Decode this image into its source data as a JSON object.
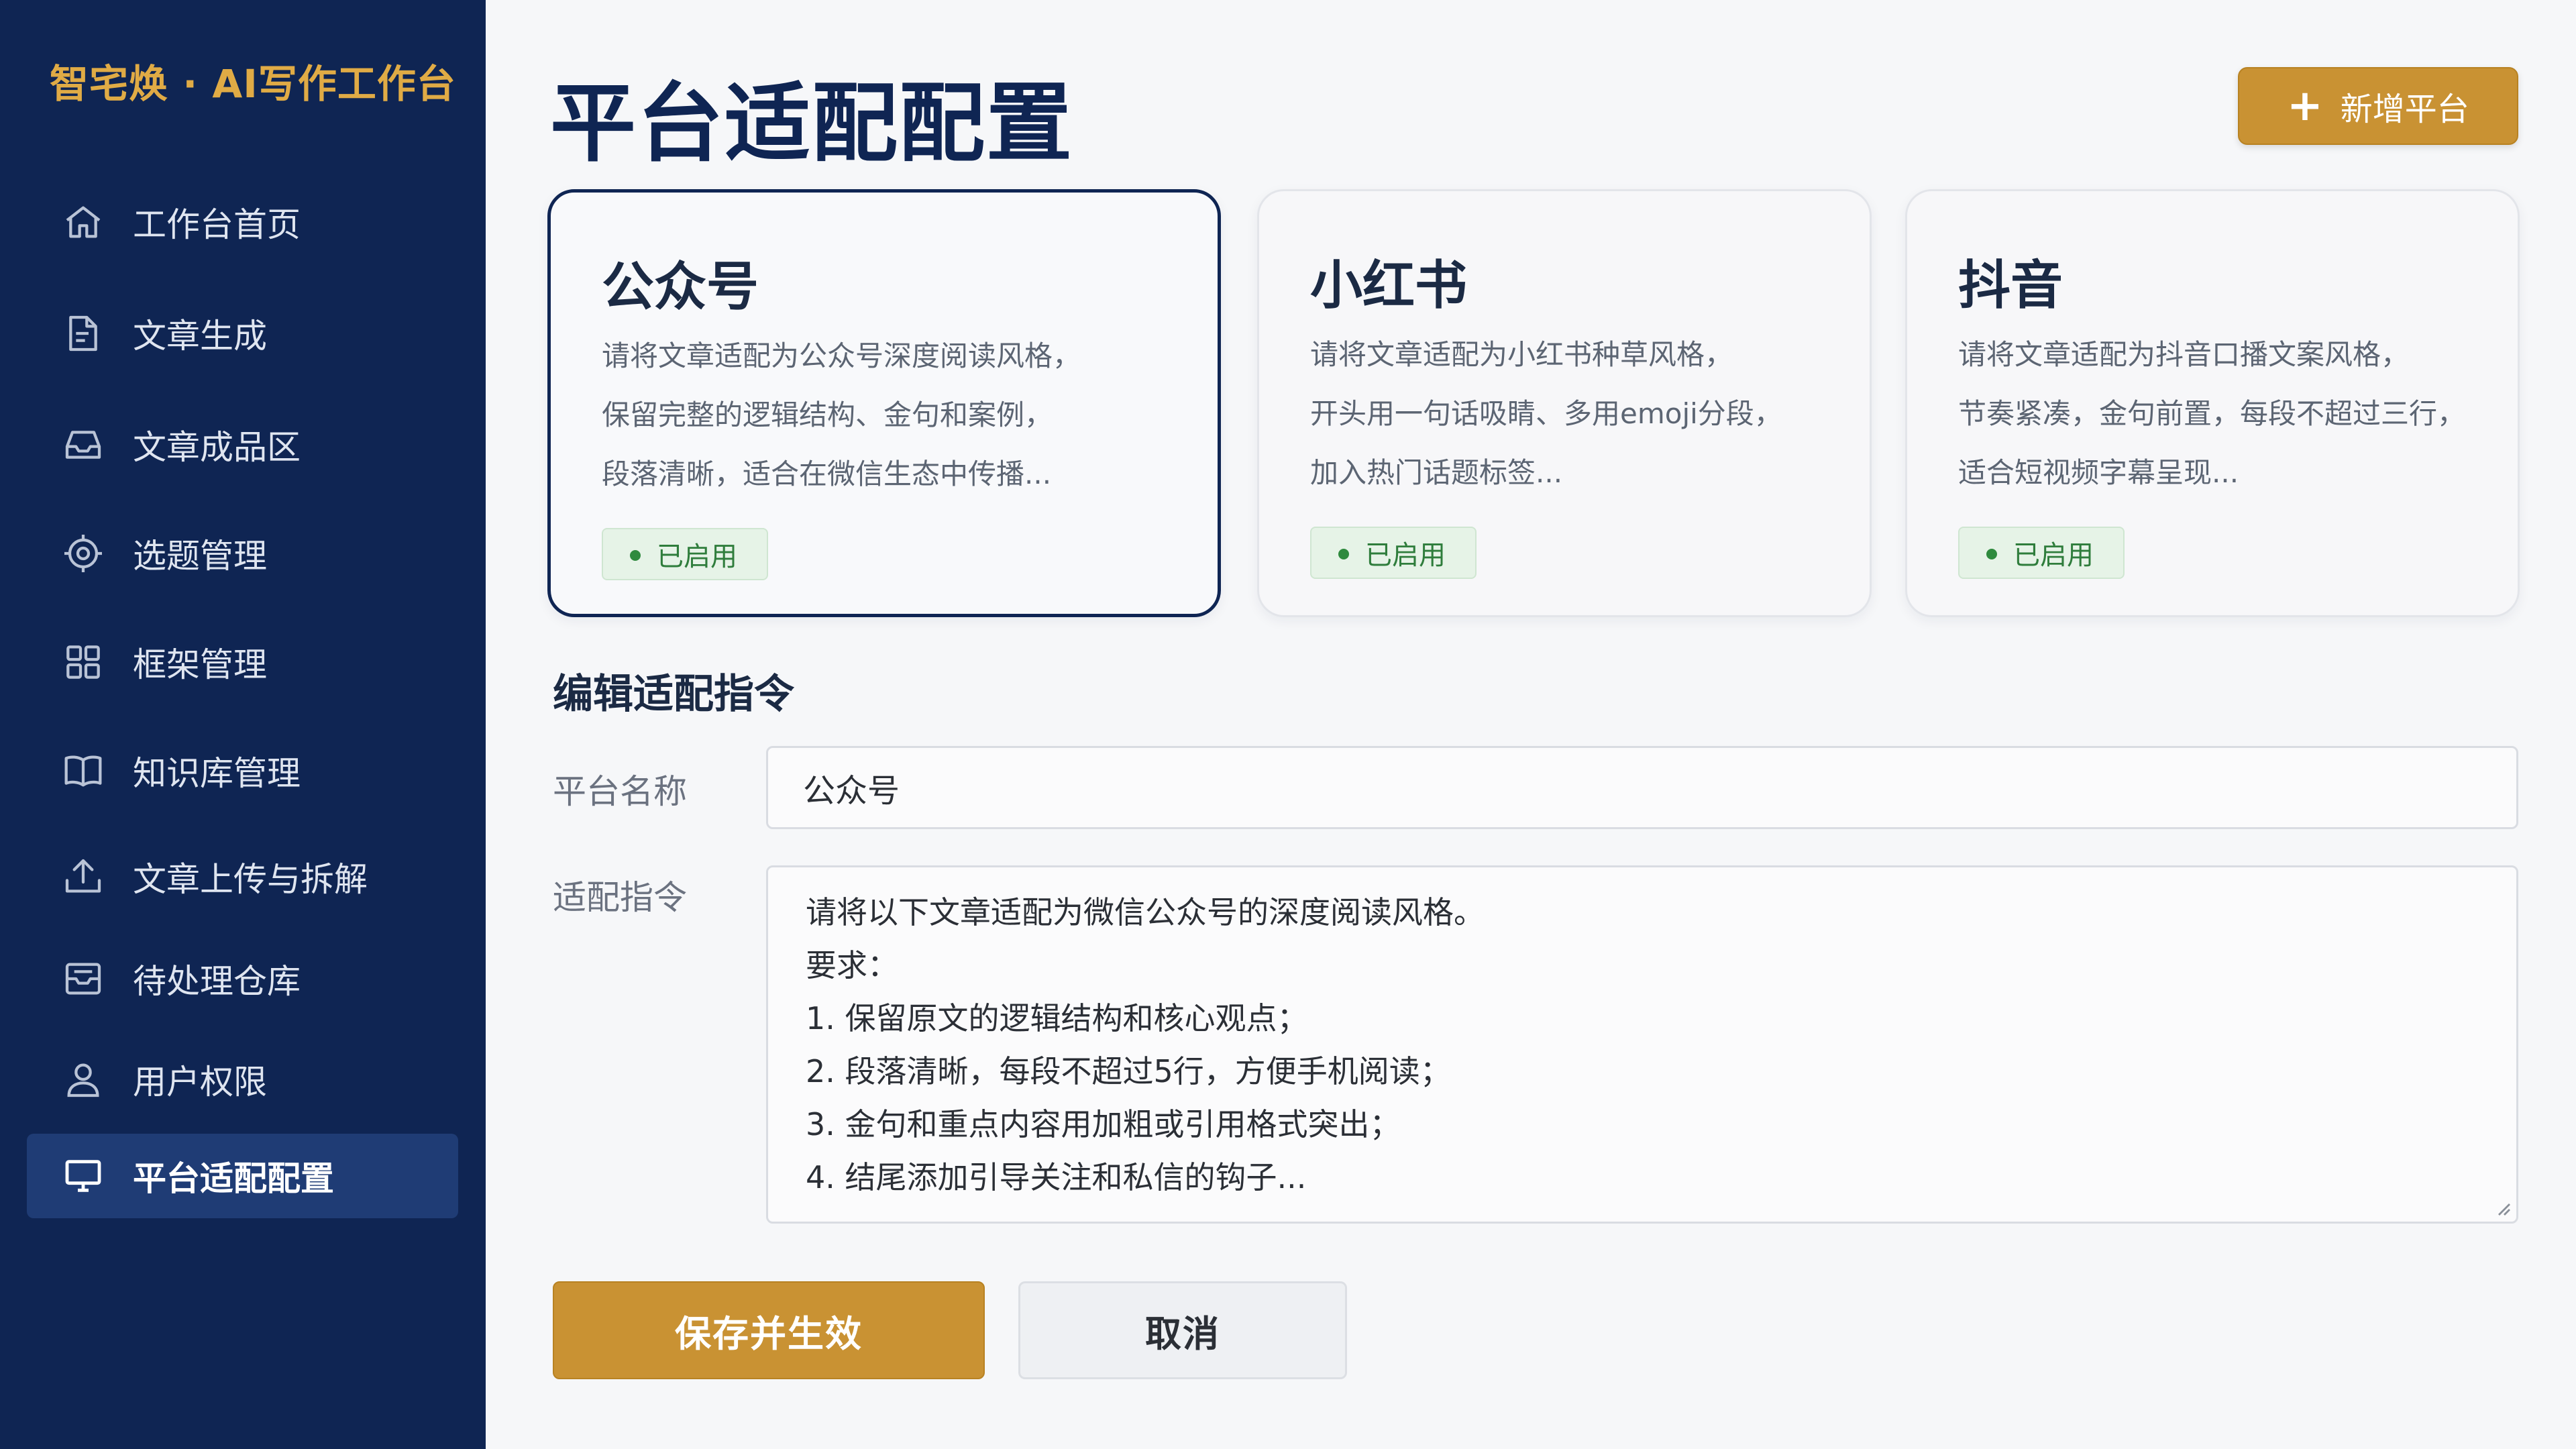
{
  "sidebar": {
    "brand": "智宅焕 · AI写作工作台",
    "items": [
      {
        "label": "工作台首页",
        "icon": "home-icon"
      },
      {
        "label": "文章生成",
        "icon": "document-edit-icon"
      },
      {
        "label": "文章成品区",
        "icon": "inbox-icon"
      },
      {
        "label": "选题管理",
        "icon": "target-icon"
      },
      {
        "label": "框架管理",
        "icon": "grid-icon"
      },
      {
        "label": "知识库管理",
        "icon": "book-icon"
      },
      {
        "label": "文章上传与拆解",
        "icon": "upload-icon"
      },
      {
        "label": "待处理仓库",
        "icon": "tray-icon"
      },
      {
        "label": "用户权限",
        "icon": "user-icon"
      },
      {
        "label": "平台适配配置",
        "icon": "monitor-icon",
        "active": true
      }
    ]
  },
  "main": {
    "title": "平台适配配置",
    "add_button": {
      "label": "新增平台",
      "icon": "plus-icon"
    },
    "cards": [
      {
        "title": "公众号",
        "desc": [
          "请将文章适配为公众号深度阅读风格，",
          "保留完整的逻辑结构、金句和案例，",
          "段落清晰，适合在微信生态中传播..."
        ],
        "status": "已启用",
        "selected": true
      },
      {
        "title": "小红书",
        "desc": [
          "请将文章适配为小红书种草风格，",
          "开头用一句话吸睛、多用emoji分段，",
          "加入热门话题标签..."
        ],
        "status": "已启用"
      },
      {
        "title": "抖音",
        "desc": [
          "请将文章适配为抖音口播文案风格，",
          "节奏紧凑，金句前置，每段不超过三行，",
          "适合短视频字幕呈现..."
        ],
        "status": "已启用"
      }
    ],
    "edit": {
      "section_title": "编辑适配指令",
      "name_label": "平台名称",
      "name_value": "公众号",
      "instruction_label": "适配指令",
      "instruction_lines": [
        "请将以下文章适配为微信公众号的深度阅读风格。",
        "要求：",
        "1. 保留原文的逻辑结构和核心观点；",
        "2. 段落清晰，每段不超过5行，方便手机阅读；",
        "3. 金句和重点内容用加粗或引用格式突出；",
        "4. 结尾添加引导关注和私信的钩子..."
      ],
      "save_label": "保存并生效",
      "cancel_label": "取消"
    }
  },
  "colors": {
    "sidebar_bg": "#0f2553",
    "brand_gold": "#e0ab45",
    "accent": "#c99233",
    "success": "#2f7d3c"
  }
}
